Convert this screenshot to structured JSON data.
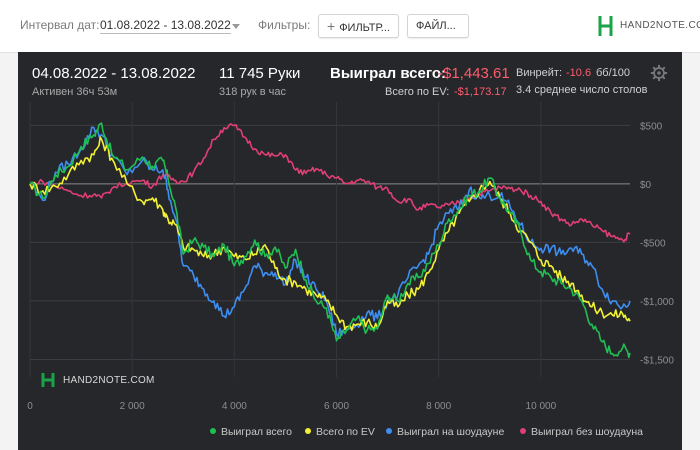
{
  "filters": {
    "interval_label": "Интервал дат:",
    "date_range": "01.08.2022 - 13.08.2022",
    "filters_label": "Фильтры:",
    "filters_button": "ФИЛЬТР...",
    "files_button": "ФАЙЛ..."
  },
  "brand": {
    "name": "HAND2NOTE.COM",
    "color": "#1aa34a"
  },
  "summary": {
    "period": "04.08.2022 - 13.08.2022",
    "active": "Активен 36ч 53м",
    "hands": "11 745 Руки",
    "hands_rate": "318 рук в час",
    "won_label": "Выиграл всего:",
    "won_value": "-$1,443.61",
    "ev_label": "Всего по EV:",
    "ev_value": "-$1,173.17",
    "winrate_label": "Винрейт:",
    "winrate_value": "-10.6",
    "winrate_unit": "бб/100",
    "tables_avg": "3.4 среднее число столов"
  },
  "chart_data": {
    "type": "line",
    "xlim": [
      0,
      11745
    ],
    "ylim": [
      -1650,
      700
    ],
    "x_ticks": [
      0,
      2000,
      4000,
      6000,
      8000,
      10000
    ],
    "x_tick_labels": [
      "0",
      "2 000",
      "4 000",
      "6 000",
      "8 000",
      "10 000"
    ],
    "y_ticks": [
      500,
      0,
      -500,
      -1000,
      -1500
    ],
    "y_tick_labels": [
      "$500",
      "$0",
      "-$500",
      "-$1,000",
      "-$1,500"
    ],
    "grid": true,
    "legend": "bottom-right",
    "series": [
      {
        "name": "Выиграл всего",
        "color": "#1fbf53",
        "x": [
          0,
          250,
          500,
          750,
          1000,
          1250,
          1400,
          1600,
          1900,
          2200,
          2400,
          2600,
          2700,
          2850,
          3000,
          3200,
          3400,
          3600,
          3800,
          4000,
          4200,
          4400,
          4600,
          4800,
          5000,
          5200,
          5400,
          5600,
          5800,
          6000,
          6200,
          6400,
          6600,
          6800,
          7000,
          7200,
          7400,
          7600,
          7800,
          8000,
          8200,
          8400,
          8600,
          8800,
          9000,
          9200,
          9400,
          9600,
          9800,
          10000,
          10200,
          10400,
          10600,
          10800,
          11000,
          11200,
          11400,
          11600,
          11745
        ],
        "values": [
          0,
          -120,
          80,
          150,
          320,
          420,
          520,
          260,
          120,
          230,
          150,
          200,
          50,
          -200,
          -600,
          -480,
          -540,
          -620,
          -520,
          -700,
          -620,
          -480,
          -620,
          -540,
          -720,
          -560,
          -820,
          -1000,
          -1060,
          -1340,
          -1250,
          -1150,
          -1250,
          -1240,
          -950,
          -1000,
          -850,
          -800,
          -680,
          -520,
          -300,
          -220,
          -100,
          -60,
          50,
          -120,
          -250,
          -400,
          -650,
          -750,
          -800,
          -850,
          -900,
          -1000,
          -1200,
          -1350,
          -1450,
          -1400,
          -1444
        ]
      },
      {
        "name": "Всего по EV",
        "color": "#f2f233",
        "x": [
          0,
          250,
          500,
          750,
          1000,
          1250,
          1400,
          1600,
          1900,
          2200,
          2400,
          2600,
          2700,
          2850,
          3000,
          3200,
          3400,
          3600,
          3800,
          4000,
          4200,
          4400,
          4600,
          4800,
          5000,
          5200,
          5400,
          5600,
          5800,
          6000,
          6200,
          6400,
          6600,
          6800,
          7000,
          7200,
          7400,
          7600,
          7800,
          8000,
          8200,
          8400,
          8600,
          8800,
          9000,
          9200,
          9400,
          9600,
          9800,
          10000,
          10200,
          10400,
          10600,
          10800,
          11000,
          11200,
          11400,
          11600,
          11745
        ],
        "values": [
          0,
          -60,
          -20,
          80,
          200,
          250,
          380,
          220,
          0,
          -150,
          -120,
          -220,
          -300,
          -350,
          -540,
          -560,
          -620,
          -600,
          -540,
          -620,
          -640,
          -600,
          -520,
          -720,
          -820,
          -840,
          -900,
          -950,
          -1000,
          -1120,
          -1220,
          -1200,
          -1180,
          -1230,
          -1000,
          -1050,
          -950,
          -900,
          -760,
          -560,
          -400,
          -250,
          -150,
          -50,
          20,
          -120,
          -250,
          -400,
          -500,
          -650,
          -700,
          -800,
          -850,
          -950,
          -1050,
          -1100,
          -1120,
          -1110,
          -1173
        ]
      },
      {
        "name": "Выиграл на шоудауне",
        "color": "#3d8ef0",
        "x": [
          0,
          250,
          500,
          750,
          1000,
          1250,
          1400,
          1600,
          1900,
          2200,
          2400,
          2600,
          2700,
          2850,
          3000,
          3200,
          3400,
          3600,
          3800,
          4000,
          4200,
          4400,
          4600,
          4800,
          5000,
          5200,
          5400,
          5600,
          5800,
          6000,
          6200,
          6400,
          6600,
          6800,
          7000,
          7200,
          7400,
          7600,
          7800,
          8000,
          8200,
          8400,
          8600,
          8800,
          9000,
          9200,
          9400,
          9600,
          9800,
          10000,
          10200,
          10400,
          10600,
          10800,
          11000,
          11200,
          11400,
          11600,
          11745
        ],
        "values": [
          0,
          -140,
          100,
          170,
          300,
          480,
          420,
          250,
          80,
          200,
          120,
          120,
          -50,
          -300,
          -700,
          -780,
          -900,
          -1000,
          -1130,
          -1050,
          -900,
          -700,
          -760,
          -760,
          -860,
          -650,
          -800,
          -900,
          -1000,
          -1280,
          -1250,
          -1200,
          -1100,
          -1150,
          -1000,
          -950,
          -800,
          -700,
          -600,
          -350,
          -250,
          -200,
          -50,
          -120,
          -100,
          -100,
          -200,
          -350,
          -500,
          -550,
          -550,
          -600,
          -550,
          -600,
          -700,
          -900,
          -1000,
          -1050,
          -1000
        ]
      },
      {
        "name": "Выиграл без шоудауна",
        "color": "#e03f74",
        "x": [
          0,
          250,
          500,
          750,
          1000,
          1250,
          1400,
          1600,
          1900,
          2200,
          2400,
          2600,
          2700,
          2850,
          3000,
          3200,
          3400,
          3600,
          3800,
          4000,
          4200,
          4400,
          4600,
          4800,
          5000,
          5200,
          5400,
          5600,
          5800,
          6000,
          6200,
          6400,
          6600,
          6800,
          7000,
          7200,
          7400,
          7600,
          7800,
          8000,
          8200,
          8400,
          8600,
          8800,
          9000,
          9200,
          9400,
          9600,
          9800,
          10000,
          10200,
          10400,
          10600,
          10800,
          11000,
          11200,
          11400,
          11600,
          11745
        ],
        "values": [
          0,
          20,
          -20,
          -60,
          -100,
          -90,
          -120,
          -40,
          10,
          30,
          -20,
          80,
          60,
          30,
          20,
          100,
          220,
          380,
          480,
          500,
          400,
          300,
          250,
          240,
          250,
          120,
          90,
          130,
          80,
          50,
          0,
          30,
          20,
          -30,
          -40,
          -150,
          -130,
          -220,
          -180,
          -200,
          -180,
          -160,
          -120,
          -80,
          -60,
          -30,
          -40,
          -50,
          -100,
          -150,
          -250,
          -300,
          -350,
          -300,
          -350,
          -400,
          -450,
          -480,
          -430
        ]
      }
    ]
  }
}
